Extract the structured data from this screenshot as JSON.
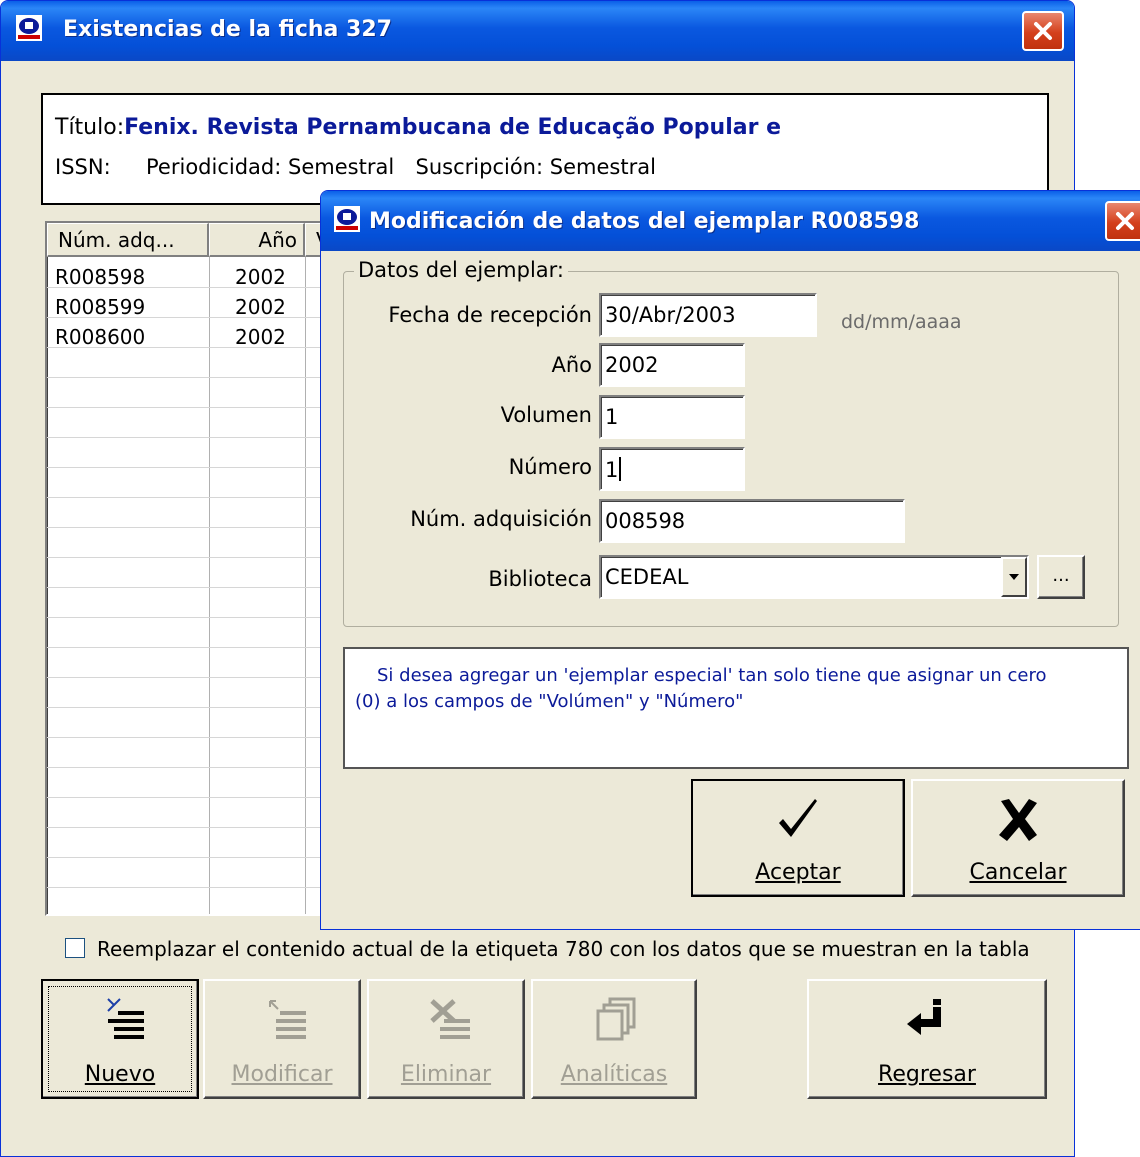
{
  "main_window": {
    "title": "Existencias de la ficha 327",
    "info": {
      "title_label": "Título:",
      "title_value": "Fenix. Revista Pernambucana de Educação Popular e",
      "issn_label": "ISSN:",
      "periodicity_label": "Periodicidad:",
      "periodicity_value": "Semestral",
      "subscription_label": "Suscripción:",
      "subscription_value": "Semestral"
    },
    "table": {
      "headers": [
        "Núm. adq...",
        "Año",
        "V"
      ],
      "rows": [
        {
          "num": "R008598",
          "year": "2002"
        },
        {
          "num": "R008599",
          "year": "2002"
        },
        {
          "num": "R008600",
          "year": "2002"
        }
      ]
    },
    "replace_checkbox": {
      "label": "Reemplazar el contenido actual de la etiqueta 780 con los datos que se muestran en la tabla",
      "checked": false
    },
    "buttons": {
      "nuevo": "Nuevo",
      "modificar": "Modificar",
      "eliminar": "Eliminar",
      "analiticas": "Analíticas",
      "regresar": "Regresar"
    }
  },
  "dialog": {
    "title": "Modificación de datos del ejemplar R008598",
    "group_label": "Datos del ejemplar:",
    "fecha": {
      "label": "Fecha de recepción",
      "value": "30/Abr/2003",
      "hint": "dd/mm/aaaa"
    },
    "anio": {
      "label": "Año",
      "value": "2002"
    },
    "volumen": {
      "label": "Volumen",
      "value": "1"
    },
    "numero": {
      "label": "Número",
      "value": "1"
    },
    "num_adq": {
      "label": "Núm. adquisición",
      "value": "008598"
    },
    "biblioteca": {
      "label": "Biblioteca",
      "value": "CEDEAL",
      "browse": "..."
    },
    "message": "Si desea agregar un 'ejemplar especial' tan solo tiene que asignar un cero (0) a los campos de \"Volúmen\" y \"Número\"",
    "buttons": {
      "aceptar": "Aceptar",
      "cancelar": "Cancelar"
    }
  },
  "colors": {
    "title_blue": "#0a58e0",
    "window_bg": "#ece9d8",
    "title_value_text": "#0b1a99",
    "message_text": "#0b1a99",
    "hint_text": "#6b6b6b",
    "close_red": "#d4401c"
  }
}
